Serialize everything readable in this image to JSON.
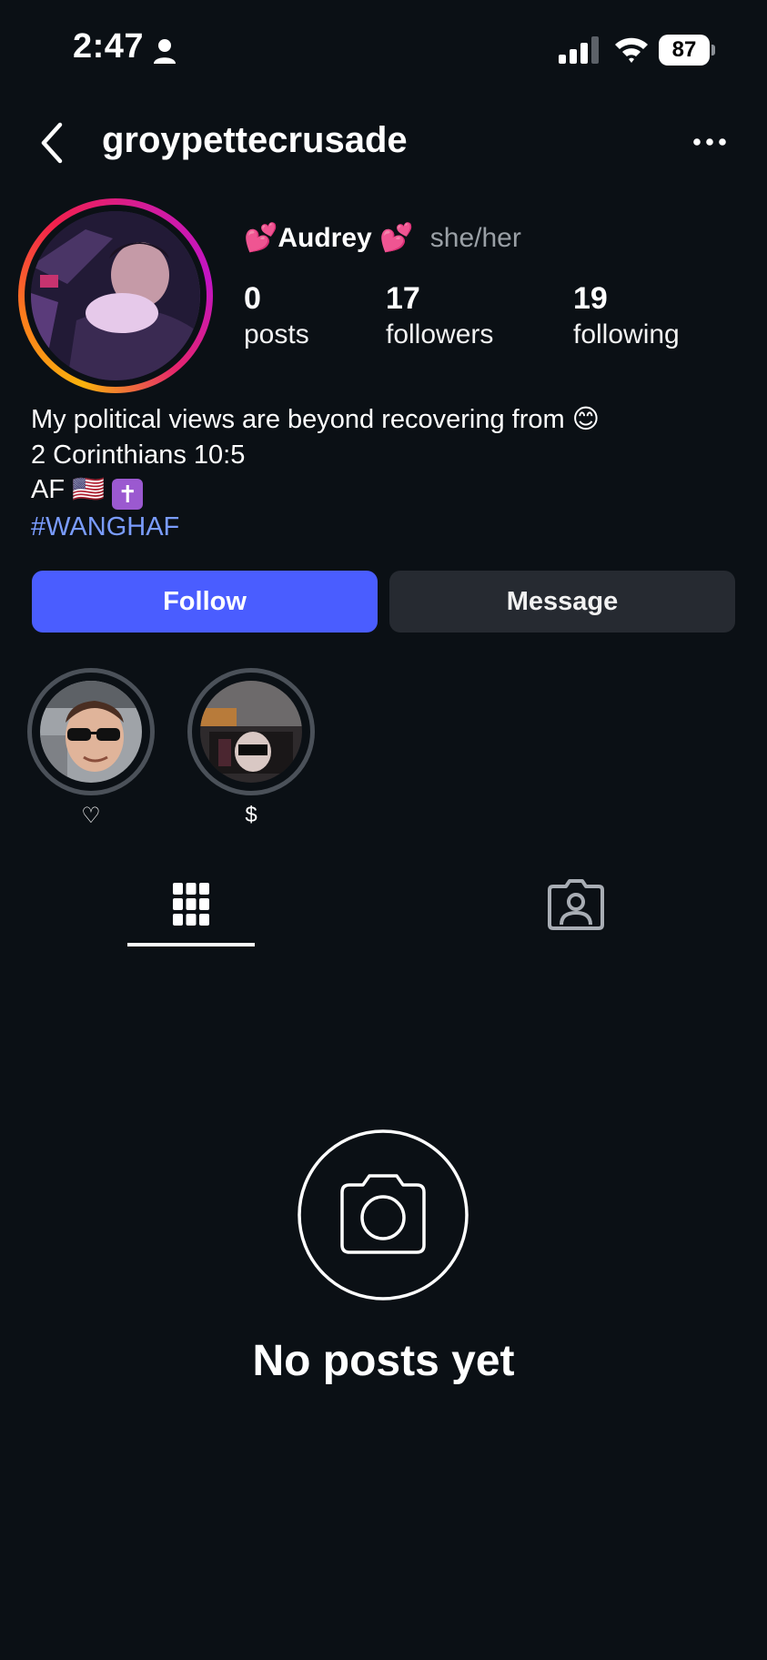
{
  "status_bar": {
    "time": "2:47",
    "battery": "87"
  },
  "header": {
    "username": "groypettecrusade"
  },
  "profile": {
    "name_emoji_left": "💕",
    "display_name": "Audrey",
    "name_emoji_right": "💕",
    "pronouns": "she/her",
    "stats": [
      {
        "value": "0",
        "label": "posts"
      },
      {
        "value": "17",
        "label": "followers"
      },
      {
        "value": "19",
        "label": "following"
      }
    ]
  },
  "bio": {
    "line1": "My political views are beyond recovering from 😊",
    "line2": "2 Corinthians 10:5",
    "line3_text": "AF 🇺🇸",
    "line3_cross": "✝",
    "hashtag": "#WANGHAF"
  },
  "actions": {
    "follow": "Follow",
    "message": "Message"
  },
  "highlights": [
    {
      "label": "♡"
    },
    {
      "label": "$"
    }
  ],
  "tabs": {
    "grid_icon": "grid-icon",
    "tagged_icon": "tagged-person-icon"
  },
  "empty_state": {
    "text": "No posts yet",
    "icon": "camera-icon"
  },
  "colors": {
    "background": "#0b1015",
    "follow_button": "#4a5dff",
    "message_button": "#262a31",
    "hashtag": "#7a9cff"
  }
}
